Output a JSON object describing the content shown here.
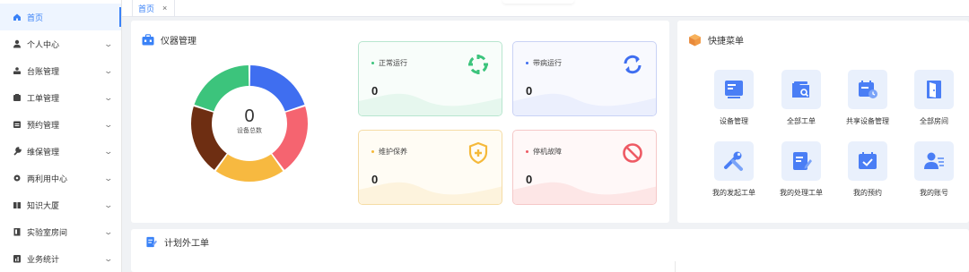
{
  "sidebar": {
    "items": [
      {
        "label": "首页",
        "icon": "home-icon",
        "active": true
      },
      {
        "label": "个人中心",
        "icon": "user-icon"
      },
      {
        "label": "台账管理",
        "icon": "ledger-icon"
      },
      {
        "label": "工单管理",
        "icon": "workorder-icon"
      },
      {
        "label": "预约管理",
        "icon": "calendar-icon"
      },
      {
        "label": "维保管理",
        "icon": "wrench-icon"
      },
      {
        "label": "两利用中心",
        "icon": "share-icon"
      },
      {
        "label": "知识大厦",
        "icon": "book-icon"
      },
      {
        "label": "实验室房间",
        "icon": "room-icon"
      },
      {
        "label": "业务统计",
        "icon": "stats-icon"
      }
    ]
  },
  "tabs": [
    {
      "label": "首页",
      "close": "×"
    }
  ],
  "instrument": {
    "title": "仪器管理",
    "total_value": "0",
    "total_label": "设备总数",
    "stats": [
      {
        "label": "正常运行",
        "value": "0",
        "color": "#3cc47c",
        "icon": "running-icon"
      },
      {
        "label": "带病运行",
        "value": "0",
        "color": "#3f6ef0",
        "icon": "refresh-icon"
      },
      {
        "label": "维护保养",
        "value": "0",
        "color": "#f5b93a",
        "icon": "shield-plus-icon"
      },
      {
        "label": "停机故障",
        "value": "0",
        "color": "#ee5a64",
        "icon": "forbidden-icon"
      }
    ],
    "donut_colors": [
      "#3f6ef0",
      "#f56470",
      "#f7b940",
      "#6e2e12",
      "#3cc47c"
    ]
  },
  "quick_menu": {
    "title": "快捷菜单",
    "items": [
      {
        "label": "设备管理",
        "icon": "device-icon"
      },
      {
        "label": "全部工单",
        "icon": "folder-search-icon"
      },
      {
        "label": "共享设备管理",
        "icon": "calendar-clock-icon"
      },
      {
        "label": "全部房间",
        "icon": "door-icon"
      },
      {
        "label": "我的发起工单",
        "icon": "tools-icon"
      },
      {
        "label": "我的处理工单",
        "icon": "edit-doc-icon"
      },
      {
        "label": "我的预约",
        "icon": "calendar-check-icon"
      },
      {
        "label": "我的账号",
        "icon": "account-icon"
      }
    ]
  },
  "plan": {
    "title": "计划外工单"
  }
}
